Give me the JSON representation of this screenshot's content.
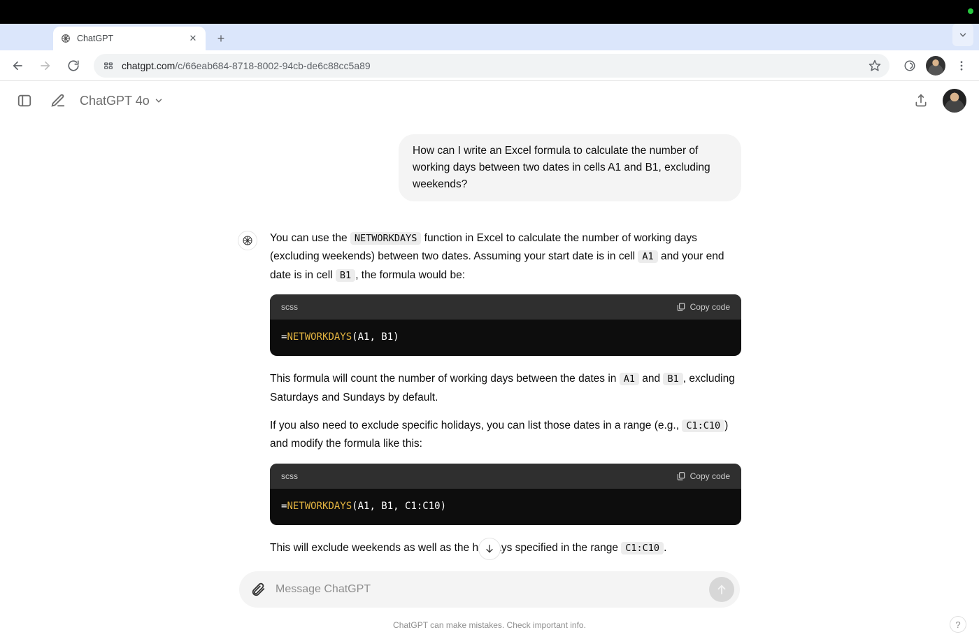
{
  "browser": {
    "tab_title": "ChatGPT",
    "url_domain": "chatgpt.com",
    "url_path": "/c/66eab684-8718-8002-94cb-de6c88cc5a89"
  },
  "app_header": {
    "model_label": "ChatGPT 4o"
  },
  "conversation": {
    "user_message": "How can I write an Excel formula to calculate the number of working days between two dates in cells A1 and B1, excluding weekends?",
    "assistant": {
      "p1_a": "You can use the ",
      "p1_code1": "NETWORKDAYS",
      "p1_b": " function in Excel to calculate the number of working days (excluding weekends) between two dates. Assuming your start date is in cell ",
      "p1_code2": "A1",
      "p1_c": " and your end date is in cell ",
      "p1_code3": "B1",
      "p1_d": ", the formula would be:",
      "code1": {
        "lang": "scss",
        "copy_label": "Copy code",
        "eq": "=",
        "fn": "NETWORKDAYS",
        "args": "(A1, B1)"
      },
      "p2_a": "This formula will count the number of working days between the dates in ",
      "p2_code1": "A1",
      "p2_b": " and ",
      "p2_code2": "B1",
      "p2_c": ", excluding Saturdays and Sundays by default.",
      "p3_a": "If you also need to exclude specific holidays, you can list those dates in a range (e.g., ",
      "p3_code1": "C1:C10",
      "p3_b": ") and modify the formula like this:",
      "code2": {
        "lang": "scss",
        "copy_label": "Copy code",
        "eq": "=",
        "fn": "NETWORKDAYS",
        "args": "(A1, B1, C1:C10)"
      },
      "p4_a": "This will exclude weekends as well as the holidays specified in the range ",
      "p4_code1": "C1:C10",
      "p4_b": "."
    }
  },
  "composer": {
    "placeholder": "Message ChatGPT"
  },
  "footer": {
    "disclaimer": "ChatGPT can make mistakes. Check important info.",
    "help": "?"
  }
}
